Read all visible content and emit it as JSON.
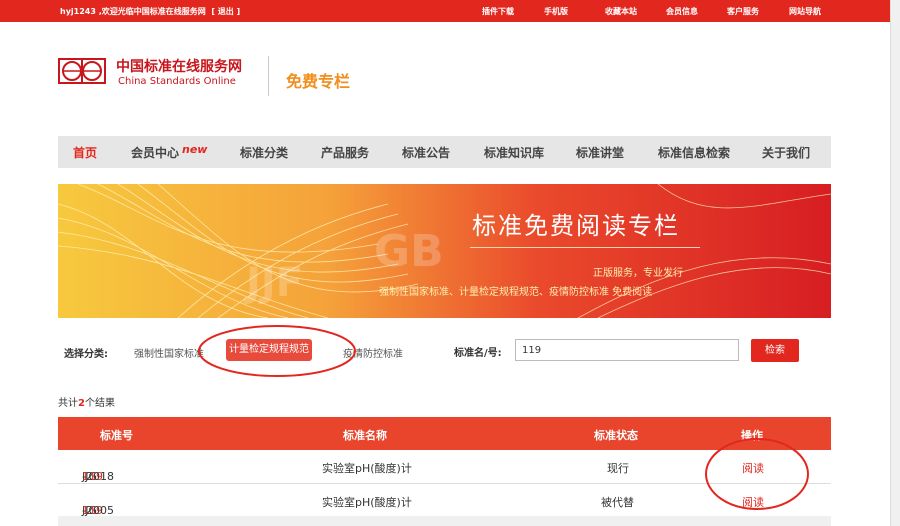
{
  "topbar": {
    "welcome": "hyj1243 ,欢迎光临中国标准在线服务网",
    "logout": "[ 退出 ]",
    "links": [
      "插件下载",
      "手机版",
      "收藏本站",
      "会员信息",
      "客户服务",
      "网站导航"
    ]
  },
  "header": {
    "site_name": "中国标准在线服务网",
    "site_name_en": "China Standards Online",
    "section_title": "免费专栏"
  },
  "nav": {
    "items": [
      "首页",
      "会员中心",
      "标准分类",
      "产品服务",
      "标准公告",
      "标准知识库",
      "标准讲堂",
      "标准信息检索",
      "关于我们"
    ],
    "new_badge": "new",
    "active": "首页"
  },
  "banner": {
    "title": "标准免费阅读专栏",
    "line1": "正版服务，专业发行",
    "line2": "强制性国家标准、计量检定规程规范、疫情防控标准 免费阅读",
    "watermark_gb": "GB",
    "watermark_jjf": "JJF"
  },
  "filter": {
    "label": "选择分类:",
    "options": [
      "强制性国家标准",
      "计量检定规程规范",
      "疫情防控标准"
    ],
    "selected": "计量检定规程规范"
  },
  "search": {
    "label": "标准名/号:",
    "value": "119",
    "button": "检索"
  },
  "results": {
    "prefix": "共计",
    "count": "2",
    "suffix": "个结果"
  },
  "table": {
    "headers": [
      "标准号",
      "标准名称",
      "标准状态",
      "操作"
    ],
    "rows": [
      {
        "num_prefix": "JJG ",
        "num_highlight": "119",
        "num_suffix": "-2018",
        "name": "实验室pH(酸度)计",
        "status": "现行",
        "action": "阅读"
      },
      {
        "num_prefix": "JJG ",
        "num_highlight": "119",
        "num_suffix": "-2005",
        "name": "实验室pH(酸度)计",
        "status": "被代替",
        "action": "阅读"
      }
    ]
  },
  "colors": {
    "brand_red": "#e2271f",
    "orange": "#f28e1c",
    "table_header": "#e8452c"
  }
}
